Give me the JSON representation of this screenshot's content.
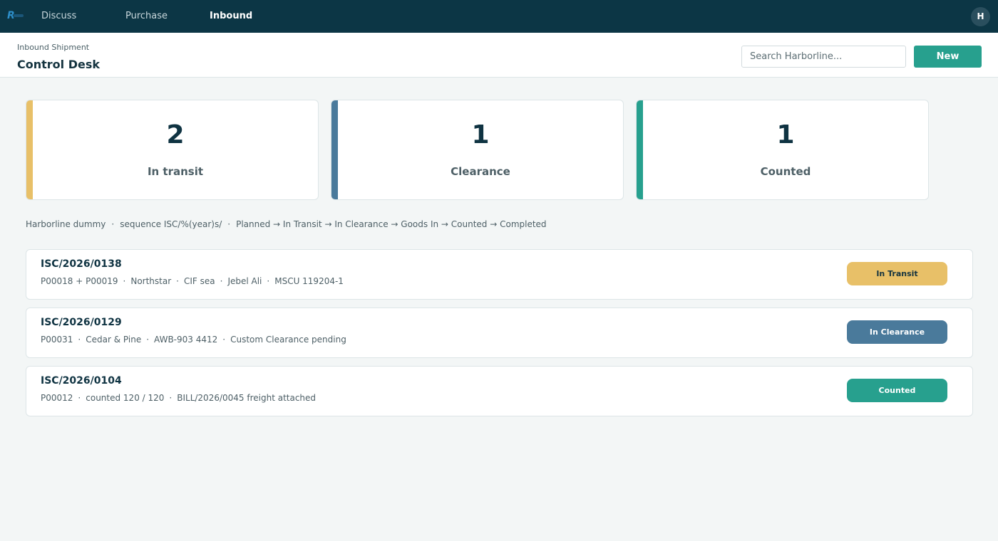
{
  "topbar": {
    "logo_icon": "harborline-logo-icon",
    "nav": [
      {
        "label": "Discuss",
        "active": false
      },
      {
        "label": "Purchase",
        "active": false
      },
      {
        "label": "Inbound",
        "active": true
      }
    ],
    "avatar_initial": "H",
    "colors": {
      "background": "#0c3645"
    }
  },
  "header": {
    "breadcrumb": "Inbound Shipment",
    "title": "Control Desk",
    "search_placeholder": "Search Harborline...",
    "new_label": "New"
  },
  "stats": [
    {
      "value": "2",
      "label": "In transit",
      "color": "#e8c068"
    },
    {
      "value": "1",
      "label": "Clearance",
      "color": "#4a7a9b"
    },
    {
      "value": "1",
      "label": "Counted",
      "color": "#27a08e"
    }
  ],
  "sequence": {
    "company": "Harborline dummy",
    "sequence": "sequence ISC/%(year)s/",
    "flow": "Planned → In Transit → In Clearance → Goods In → Counted → Completed",
    "separator": "·"
  },
  "shipments": [
    {
      "ref": "ISC/2026/0138",
      "meta": [
        "P00018 + P00019",
        "Northstar",
        "CIF sea",
        "Jebel Ali",
        "MSCU 119204-1"
      ],
      "status": "In Transit",
      "status_bg": "#e8c068",
      "status_fg": "#14333f"
    },
    {
      "ref": "ISC/2026/0129",
      "meta": [
        "P00031",
        "Cedar & Pine",
        "AWB-903 4412",
        "Custom Clearance pending"
      ],
      "status": "In Clearance",
      "status_bg": "#4a7a9b",
      "status_fg": "#ffffff"
    },
    {
      "ref": "ISC/2026/0104",
      "meta": [
        "P00012",
        "counted 120 / 120",
        "BILL/2026/0045 freight attached"
      ],
      "status": "Counted",
      "status_bg": "#27a08e",
      "status_fg": "#ffffff"
    }
  ]
}
